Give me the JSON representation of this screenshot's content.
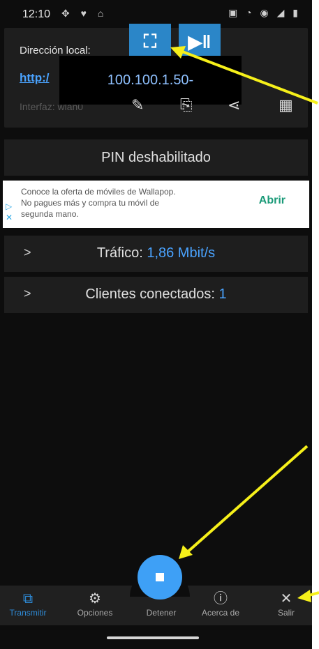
{
  "status": {
    "time": "12:10"
  },
  "local_card": {
    "label": "Dirección local:",
    "url_text": "http:/",
    "interface_label": "Interfaz: wlan0",
    "ip_overlay": "100.100.1.50-"
  },
  "pin_status": "PIN deshabilitado",
  "ad": {
    "line1": "Conoce la oferta de móviles de Wallapop.",
    "line2": "No pagues más y compra tu móvil de",
    "line3": "segunda mano.",
    "action": "Abrir"
  },
  "traffic": {
    "label": "Tráfico:",
    "value": "1,86 Mbit/s"
  },
  "clients": {
    "label": "Clientes conectados:",
    "value": "1"
  },
  "nav": [
    {
      "label": "Transmitir",
      "icon": "cast-icon",
      "active": true
    },
    {
      "label": "Opciones",
      "icon": "gear-icon"
    },
    {
      "label": "Detener",
      "icon": "stop-icon"
    },
    {
      "label": "Acerca de",
      "icon": "info-icon"
    },
    {
      "label": "Salir",
      "icon": "close-icon"
    }
  ],
  "colors": {
    "accent": "#3ea0f6",
    "link": "#4aa3ff",
    "arrow": "#f6f01a"
  }
}
